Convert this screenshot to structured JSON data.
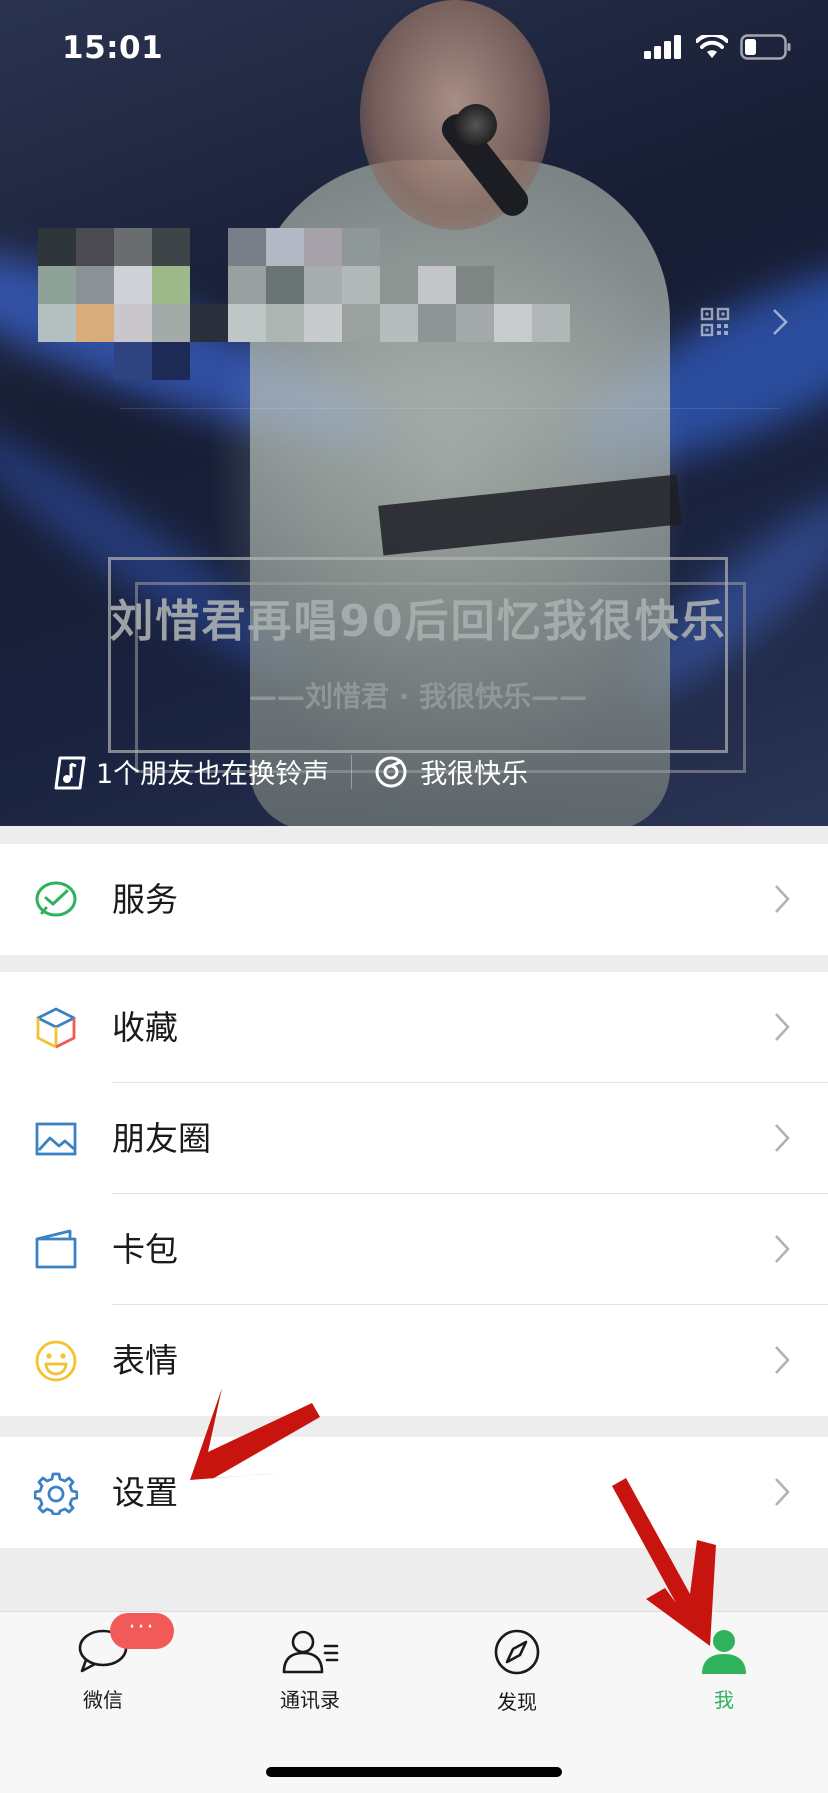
{
  "status_bar": {
    "time": "15:01"
  },
  "profile": {
    "song_title": "刘惜君再唱90后回忆我很快乐",
    "song_subtitle": "——刘惜君 · 我很快乐——",
    "ringtone_friends": "1个朋友也在换铃声",
    "song_name": "我很快乐"
  },
  "menu": {
    "groups": [
      {
        "items": [
          {
            "label": "服务",
            "icon": "wechat-pay-icon",
            "color": "#2fb25c"
          }
        ]
      },
      {
        "items": [
          {
            "label": "收藏",
            "icon": "favorites-cube-icon"
          },
          {
            "label": "朋友圈",
            "icon": "moments-image-icon",
            "color": "#3b82c4"
          },
          {
            "label": "卡包",
            "icon": "card-wallet-icon",
            "color": "#3b82c4"
          },
          {
            "label": "表情",
            "icon": "smiley-icon",
            "color": "#f2c230"
          }
        ]
      },
      {
        "items": [
          {
            "label": "设置",
            "icon": "settings-gear-icon",
            "color": "#3b82c4"
          }
        ]
      }
    ]
  },
  "tabbar": {
    "badge": "···",
    "tabs": [
      {
        "label": "微信",
        "icon": "chat-bubble-icon"
      },
      {
        "label": "通讯录",
        "icon": "contacts-icon"
      },
      {
        "label": "发现",
        "icon": "compass-icon"
      },
      {
        "label": "我",
        "icon": "person-icon",
        "active": true
      }
    ]
  },
  "colors": {
    "accent": "#2fb25c",
    "badge": "#f25a5a",
    "annotation_arrow": "#c8140f"
  }
}
